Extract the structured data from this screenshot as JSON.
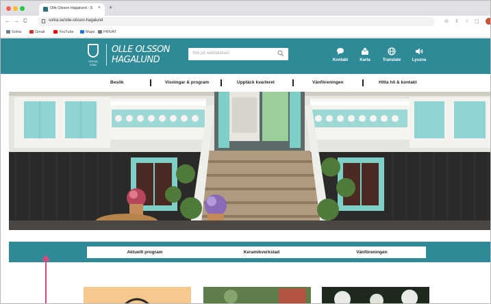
{
  "browser": {
    "tab_title": "Olle Olsson Hagalund - Solna",
    "tab_close": "×",
    "new_tab": "+",
    "nav_back": "←",
    "nav_forward": "→",
    "nav_reload": "C",
    "url": "solna.se/olle-olsson-hagalund",
    "address_icons": [
      "⊙",
      "⇧",
      "☆",
      "▢"
    ],
    "bookmarks": [
      {
        "label": "Solna",
        "icon": "folder-icon",
        "color": "#6e7d8a"
      },
      {
        "label": "Gmail",
        "icon": "gmail-icon",
        "color": "#d93025"
      },
      {
        "label": "YouTube",
        "icon": "youtube-icon",
        "color": "#ff0000"
      },
      {
        "label": "Maps",
        "icon": "maps-icon",
        "color": "#1a73e8"
      },
      {
        "label": "PRIVAT",
        "icon": "folder-icon",
        "color": "#6e7d8a"
      }
    ]
  },
  "site": {
    "crest_label": "SOLNA STAD",
    "logo_line1": "OLLE OLSSON",
    "logo_line2": "HAGALUND",
    "search_placeholder": "Sök på webbplatsen",
    "header_actions": [
      {
        "label": "Kontakt",
        "icon": "chat-bubble-icon",
        "glyph": "●"
      },
      {
        "label": "Karta",
        "icon": "map-pins-icon",
        "glyph": "⚲"
      },
      {
        "label": "Translate",
        "icon": "globe-icon",
        "glyph": "⊕"
      },
      {
        "label": "Lyssna",
        "icon": "speaker-icon",
        "glyph": "◀)"
      }
    ],
    "main_nav": [
      "Besök",
      "Visningar & program",
      "Upptäck kvarteret",
      "Vänföreningen",
      "Hitta hit & kontakt"
    ],
    "quick_links": [
      "Aktuellt program",
      "Keramikverkstad",
      "Vänföreningen"
    ],
    "colors": {
      "brand": "#2f8a97",
      "annotation": "#e0457b"
    }
  }
}
